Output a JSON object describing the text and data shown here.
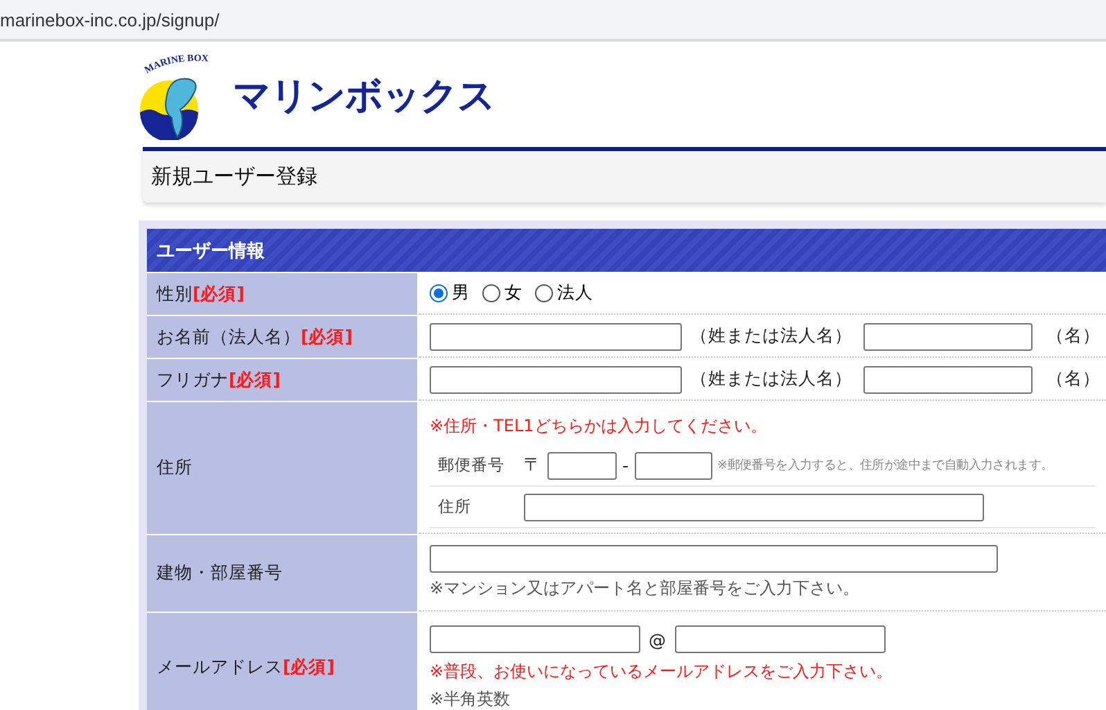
{
  "url": "marinebox-inc.co.jp/signup/",
  "logo": {
    "tagline": "MARINE BOX",
    "name": "マリンボックス"
  },
  "page_title": "新規ユーザー登録",
  "section_title": "ユーザー情報",
  "rows": [
    {
      "kind": "radio",
      "label": "性別",
      "required": "[必須]",
      "options": [
        {
          "label": "男",
          "selected": true
        },
        {
          "label": "女",
          "selected": false
        },
        {
          "label": "法人",
          "selected": false
        }
      ]
    },
    {
      "kind": "name_pair",
      "label": "お名前（法人名）",
      "required": "[必須]",
      "first_caption": "（姓または法人名）",
      "second_caption": "（名）"
    },
    {
      "kind": "name_pair",
      "label": "フリガナ",
      "required": "[必須]",
      "first_caption": "（姓または法人名）",
      "second_caption": "（名）"
    },
    {
      "kind": "address",
      "label": "住所",
      "warning": "※住所・TEL1どちらかは入力してください。",
      "postal_label": "郵便番号",
      "postal_mark": "〒",
      "postal_dash": "-",
      "postal_note": "※郵便番号を入力すると、住所が途中まで自動入力されます。",
      "address_label": "住所"
    },
    {
      "kind": "text_note",
      "label": "建物・部屋番号",
      "note": "※マンション又はアパート名と部屋番号をご入力下さい。"
    },
    {
      "kind": "email",
      "label": "メールアドレス",
      "required": "[必須]",
      "at": "@",
      "warning": "※普段、お使いになっているメールアドレスをご入力下さい。",
      "note": "※半角英数"
    }
  ]
}
